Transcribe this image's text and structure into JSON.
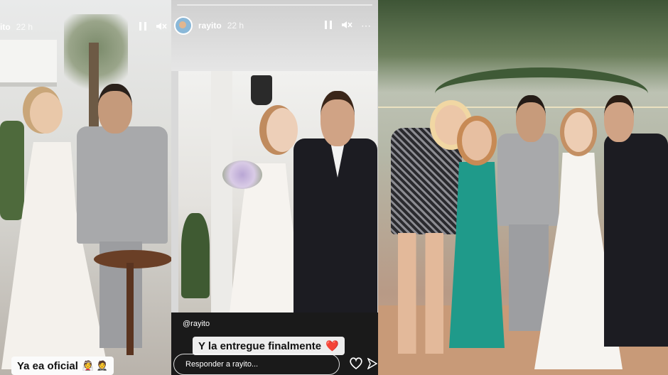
{
  "story_left": {
    "username_partial": "ito",
    "time": "22 h",
    "caption": "Ya ea oficial",
    "caption_emojis": "👰 🤵"
  },
  "story_middle": {
    "username": "rayito",
    "time": "22 h",
    "mention": "@rayito",
    "caption": "Y la entregue finalmente",
    "caption_emoji": "❤️",
    "reply_placeholder": "Responder a rayito..."
  },
  "colors": {
    "caption_bg": "#ffffff",
    "heart": "#d9363e",
    "dress": "#f4f1ec",
    "suit_gray": "#a8a9ab",
    "tux_black": "#1c1c22",
    "teal_dress": "#1f9a8a"
  },
  "icons": [
    "pause-icon",
    "mute-icon",
    "heart-icon",
    "send-icon"
  ]
}
